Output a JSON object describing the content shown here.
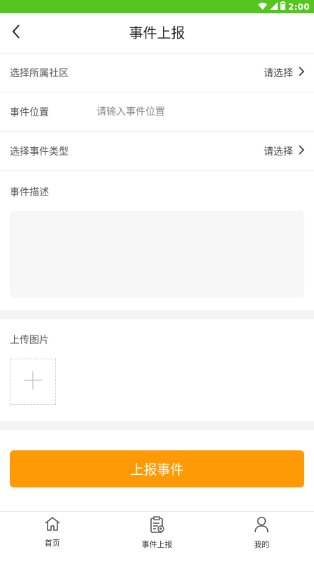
{
  "status_bar": {
    "time": "2:00",
    "icons": [
      "wifi-icon",
      "signal-icon",
      "battery-icon"
    ],
    "bg_color": "#55c51f"
  },
  "header": {
    "title": "事件上报",
    "back_icon": "chevron-left-icon"
  },
  "form": {
    "community": {
      "label": "选择所属社区",
      "value": "请选择"
    },
    "location": {
      "label": "事件位置",
      "placeholder": "请输入事件位置",
      "value": ""
    },
    "event_type": {
      "label": "选择事件类型",
      "value": "请选择"
    },
    "description": {
      "label": "事件描述",
      "value": ""
    },
    "upload": {
      "label": "上传图片",
      "icon": "plus-icon"
    }
  },
  "submit": {
    "label": "上报事件",
    "color": "#fe9a05"
  },
  "tabbar": {
    "items": [
      {
        "label": "首页",
        "icon": "home-icon"
      },
      {
        "label": "事件上报",
        "icon": "report-clipboard-icon"
      },
      {
        "label": "我的",
        "icon": "user-icon"
      }
    ]
  }
}
